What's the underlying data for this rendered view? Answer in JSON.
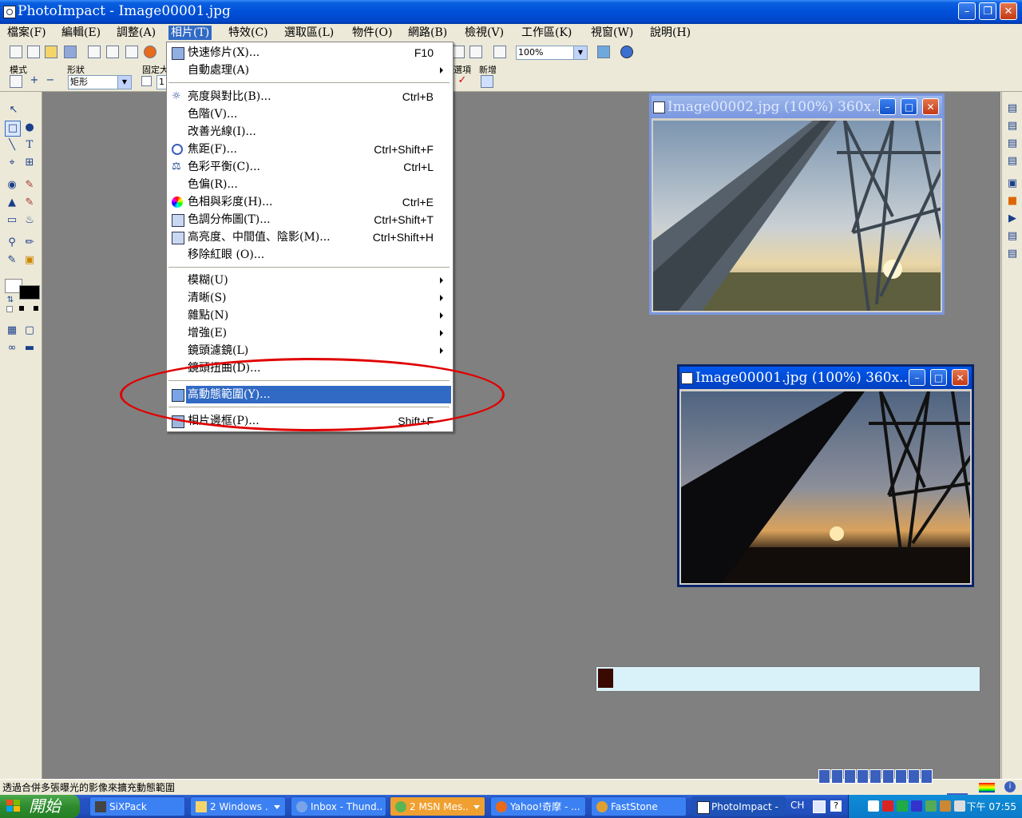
{
  "window": {
    "title": "PhotoImpact - Image00001.jpg"
  },
  "menubar": [
    "檔案(F)",
    "編輯(E)",
    "調整(A)",
    "相片(T)",
    "特效(C)",
    "選取區(L)",
    "物件(O)",
    "網路(B)",
    "檢視(V)",
    "工作區(K)",
    "視窗(W)",
    "說明(H)"
  ],
  "toolbar": {
    "zoom_value": "100%",
    "mode_label": "模式",
    "shape_label": "形狀",
    "shape_value": "矩形",
    "fixed_label": "固定大",
    "fixed_value": "1",
    "options_label": "選項",
    "new_label": "新增"
  },
  "menu": {
    "items": [
      {
        "label": "快速修片(X)...",
        "shortcut": "F10"
      },
      {
        "label": "自動處理(A)",
        "submenu": true
      },
      {
        "label": "亮度與對比(B)...",
        "shortcut": "Ctrl+B"
      },
      {
        "label": "色階(V)..."
      },
      {
        "label": "改善光線(I)..."
      },
      {
        "label": "焦距(F)...",
        "shortcut": "Ctrl+Shift+F"
      },
      {
        "label": "色彩平衡(C)...",
        "shortcut": "Ctrl+L"
      },
      {
        "label": "色偏(R)..."
      },
      {
        "label": "色相與彩度(H)...",
        "shortcut": "Ctrl+E"
      },
      {
        "label": "色調分佈圖(T)...",
        "shortcut": "Ctrl+Shift+T"
      },
      {
        "label": "高亮度、中間值、陰影(M)...",
        "shortcut": "Ctrl+Shift+H"
      },
      {
        "label": "移除紅眼 (O)..."
      },
      {
        "label": "模糊(U)",
        "submenu": true
      },
      {
        "label": "清晰(S)",
        "submenu": true
      },
      {
        "label": "雜點(N)",
        "submenu": true
      },
      {
        "label": "增強(E)",
        "submenu": true
      },
      {
        "label": "鏡頭濾鏡(L)",
        "submenu": true
      },
      {
        "label": "鏡頭扭曲(D)..."
      },
      {
        "label": "高動態範圍(Y)...",
        "highlighted": true
      },
      {
        "label": "相片邊框(P)...",
        "shortcut": "Shift+F"
      }
    ]
  },
  "windows": {
    "image2": {
      "title": "Image00002.jpg (100%) 360x..."
    },
    "image1": {
      "title": "Image00001.jpg (100%) 360x..."
    }
  },
  "progress": {
    "value": 0.04
  },
  "statusbar": {
    "text": "透過合併多張曝光的影像來擴充動態範圍"
  },
  "taskbar": {
    "start_label": "開始",
    "tasks": [
      {
        "label": "SiXPack"
      },
      {
        "label": "2 Windows ..."
      },
      {
        "label": "Inbox - Thund..."
      },
      {
        "label": "2 MSN Mes..."
      },
      {
        "label": "Yahoo!奇摩 - ..."
      },
      {
        "label": "FastStone"
      },
      {
        "label": "PhotoImpact - ..."
      }
    ],
    "language": "CH",
    "clock": "下午 07:55"
  }
}
